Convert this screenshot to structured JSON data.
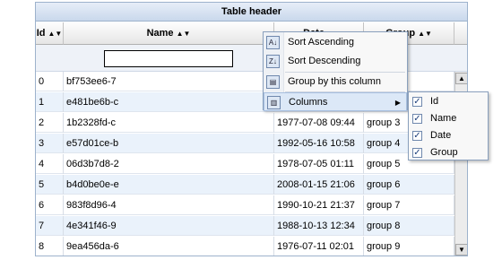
{
  "table": {
    "title": "Table header",
    "columns": {
      "id": "Id",
      "name": "Name",
      "date": "Date",
      "group": "Group"
    },
    "filter_value": "",
    "rows": [
      {
        "id": "0",
        "name": "bf753ee6-7",
        "date": "",
        "group": ""
      },
      {
        "id": "1",
        "name": "e481be6b-c",
        "date": "",
        "group": ""
      },
      {
        "id": "2",
        "name": "1b2328fd-c",
        "date": "1977-07-08 09:44",
        "group": "group 3"
      },
      {
        "id": "3",
        "name": "e57d01ce-b",
        "date": "1992-05-16 10:58",
        "group": "group 4"
      },
      {
        "id": "4",
        "name": "06d3b7d8-2",
        "date": "1978-07-05 01:11",
        "group": "group 5"
      },
      {
        "id": "5",
        "name": "b4d0be0e-e",
        "date": "2008-01-15 21:06",
        "group": "group 6"
      },
      {
        "id": "6",
        "name": "983f8d96-4",
        "date": "1990-10-21 21:37",
        "group": "group 7"
      },
      {
        "id": "7",
        "name": "4e341f46-9",
        "date": "1988-10-13 12:34",
        "group": "group 8"
      },
      {
        "id": "8",
        "name": "9ea456da-6",
        "date": "1976-07-11 02:01",
        "group": "group 9"
      }
    ]
  },
  "context_menu": {
    "sort_asc": "Sort Ascending",
    "sort_desc": "Sort Descending",
    "group_by": "Group by this column",
    "columns": "Columns"
  },
  "columns_submenu": {
    "items": [
      {
        "label": "Id",
        "checked": true
      },
      {
        "label": "Name",
        "checked": true
      },
      {
        "label": "Date",
        "checked": true
      },
      {
        "label": "Group",
        "checked": true
      }
    ]
  },
  "icons": {
    "sort_asc": "sort-ascending-icon",
    "sort_desc": "sort-descending-icon",
    "group_by": "group-by-icon",
    "columns": "columns-icon",
    "scroll_up": "scroll-up-arrow-icon",
    "scroll_down": "scroll-down-arrow-icon"
  },
  "colors": {
    "alt_row": "#eaf2fb",
    "header_border": "#9db2cc",
    "menu_border": "#8aa0bd"
  }
}
